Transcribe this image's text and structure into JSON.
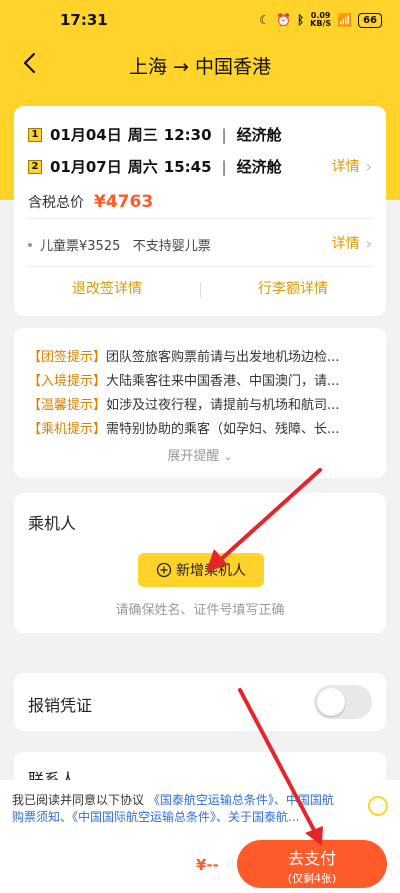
{
  "status_bar": {
    "time": "17:31",
    "network_speed": "0.09\nKB/S",
    "battery": "66"
  },
  "nav": {
    "title": "上海 → 中国香港"
  },
  "itinerary": {
    "segments": [
      {
        "index": "1",
        "date": "01月04日",
        "weekday": "周三",
        "time": "12:30",
        "cabin": "经济舱"
      },
      {
        "index": "2",
        "date": "01月07日",
        "weekday": "周六",
        "time": "15:45",
        "cabin": "经济舱"
      }
    ],
    "details_label": "详情",
    "price_label": "含税总价",
    "price": "¥4763",
    "child_info": "儿童票¥3525   不支持婴儿票",
    "child_details_label": "详情",
    "refund_label": "退改签详情",
    "baggage_label": "行李额详情"
  },
  "tips": {
    "items": [
      {
        "tag": "【团签提示】",
        "text": "团队签旅客购票前请与出发地机场边检..."
      },
      {
        "tag": "【入境提示】",
        "text": "大陆乘客往来中国香港、中国澳门，请..."
      },
      {
        "tag": "【温馨提示】",
        "text": "如涉及过夜行程，请提前与机场和航司..."
      },
      {
        "tag": "【乘机提示】",
        "text": "需特别协助的乘客（如孕妇、残障、长..."
      }
    ],
    "expand_label": "展开提醒"
  },
  "passengers": {
    "title": "乘机人",
    "add_label": "新增乘机人",
    "hint": "请确保姓名、证件号填写正确"
  },
  "receipt": {
    "label": "报销凭证"
  },
  "contact": {
    "label": "联系人"
  },
  "footer": {
    "agree_prefix": "我已阅读并同意以下协议",
    "agree_links": "《国泰航空运输总条件》、中国国航购票须知、《中国国际航空运输总条件》、关于国泰航...",
    "total": "¥--",
    "pay_label": "去支付",
    "pay_sub": "(仅剩4张)"
  },
  "colors": {
    "brand_yellow": "#ffd32a",
    "accent_orange": "#ff5a2a",
    "link_gold": "#d99a00",
    "link_blue": "#2f6fd6"
  }
}
